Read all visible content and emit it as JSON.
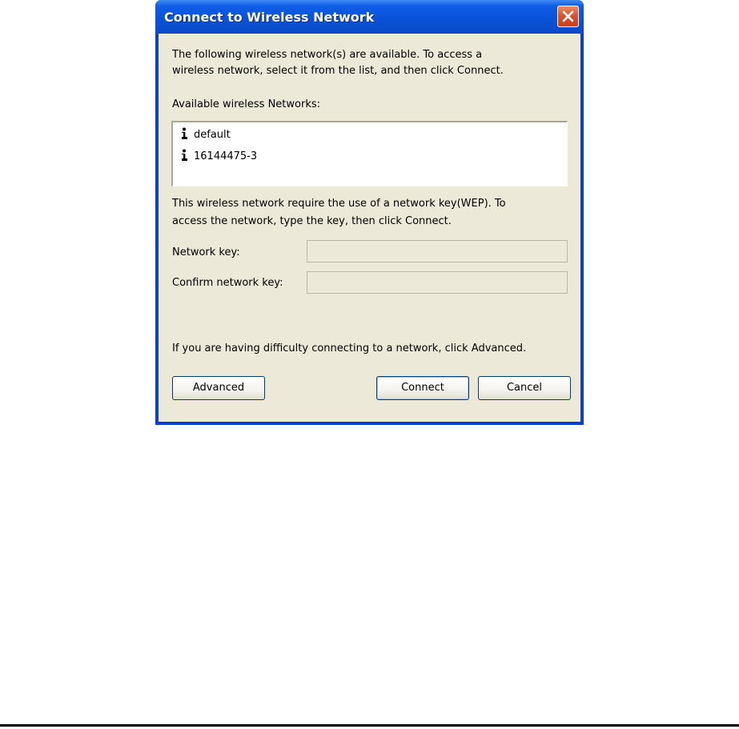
{
  "window": {
    "title": "Connect to Wireless Network"
  },
  "intro": {
    "line1": "The following wireless network(s) are available. To access a",
    "line2": "wireless network, select it from the list, and then click Connect."
  },
  "networks_label": "Available wireless Networks:",
  "networks": [
    {
      "name": "default",
      "icon": "wireless-network-icon"
    },
    {
      "name": "16144475-3",
      "icon": "wireless-network-icon"
    }
  ],
  "wep_notice": {
    "line1": "This wireless network require the use of a network key(WEP). To",
    "line2": "access the network, type the key, then click Connect."
  },
  "network_key": {
    "label": "Network key:",
    "value": ""
  },
  "confirm_key": {
    "label": "Confirm network key:",
    "value": ""
  },
  "help_text": "If you are having difficulty connecting to a network, click Advanced.",
  "buttons": {
    "advanced": "Advanced",
    "connect": "Connect",
    "cancel": "Cancel"
  },
  "colors": {
    "title_bar": "#0a53d9",
    "dialog_face": "#ece9d8",
    "close_button": "#d9502a"
  }
}
